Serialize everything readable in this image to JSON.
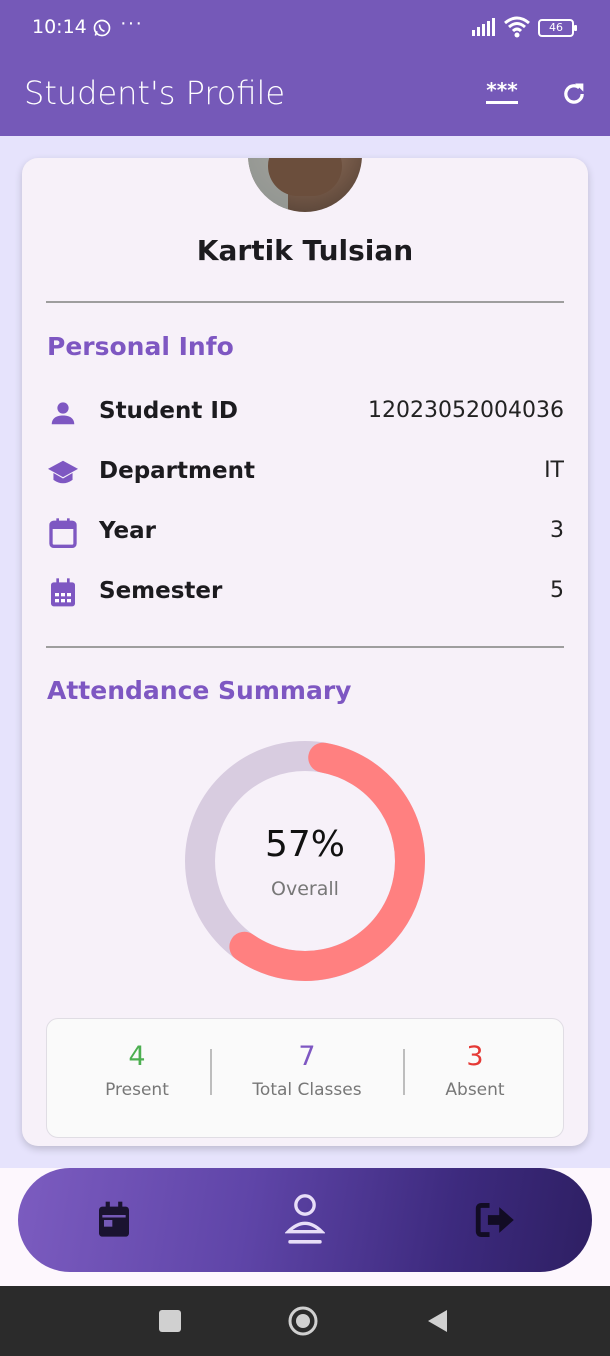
{
  "status_bar": {
    "time": "10:14",
    "overflow": "···",
    "battery": "46"
  },
  "appbar": {
    "title": "Student's Profile",
    "password_icon": "***"
  },
  "profile": {
    "name": "Kartik Tulsian"
  },
  "personal_info": {
    "title": "Personal Info",
    "rows": [
      {
        "icon": "person-icon",
        "label": "Student ID",
        "value": "12023052004036"
      },
      {
        "icon": "school-icon",
        "label": "Department",
        "value": "IT"
      },
      {
        "icon": "calendar-icon",
        "label": "Year",
        "value": "3"
      },
      {
        "icon": "calendar-month-icon",
        "label": "Semester",
        "value": "5"
      }
    ]
  },
  "attendance": {
    "title": "Attendance Summary",
    "percent_label": "57%",
    "percent_value": 0.57,
    "caption": "Overall",
    "present": {
      "value": "4",
      "label": "Present"
    },
    "total": {
      "value": "7",
      "label": "Total Classes"
    },
    "absent": {
      "value": "3",
      "label": "Absent"
    }
  },
  "colors": {
    "primary": "#7559B8",
    "accent_text": "#7E57C2",
    "donut_fill": "#FF8080",
    "donut_track": "#D8CCE0",
    "present": "#4CAF50",
    "total": "#7E57C2",
    "absent": "#E53935"
  },
  "bottom_nav": [
    "calendar-icon",
    "profile-icon",
    "logout-icon"
  ]
}
